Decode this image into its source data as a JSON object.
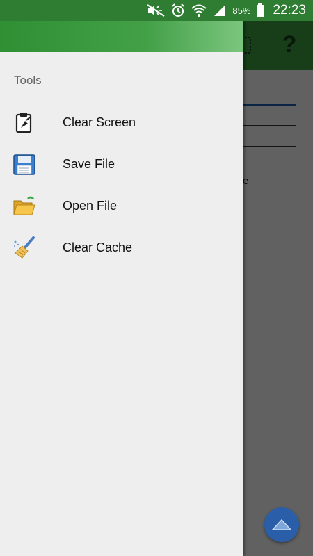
{
  "status_bar": {
    "battery_percent": "85%",
    "time": "22:23",
    "icons": [
      "mute-icon",
      "alarm-icon",
      "wifi-icon",
      "signal-icon",
      "battery-icon"
    ]
  },
  "drawer": {
    "section_title": "Tools",
    "items": [
      {
        "label": "Clear Screen",
        "icon": "clipboard-pen-icon"
      },
      {
        "label": "Save File",
        "icon": "floppy-disk-icon"
      },
      {
        "label": "Open File",
        "icon": "open-folder-icon"
      },
      {
        "label": "Clear Cache",
        "icon": "broom-icon"
      }
    ]
  },
  "background_app": {
    "toolbar_icons": [
      "grid-icon",
      "help-icon"
    ],
    "help_glyph": "?",
    "partial_text": "e",
    "fab_icon": "chevron-up-icon"
  },
  "colors": {
    "status_bar": "#2f7d32",
    "toolbar": "#3a9a3f",
    "drawer_bg": "#eeeeee",
    "fab": "#2a5ea8"
  }
}
